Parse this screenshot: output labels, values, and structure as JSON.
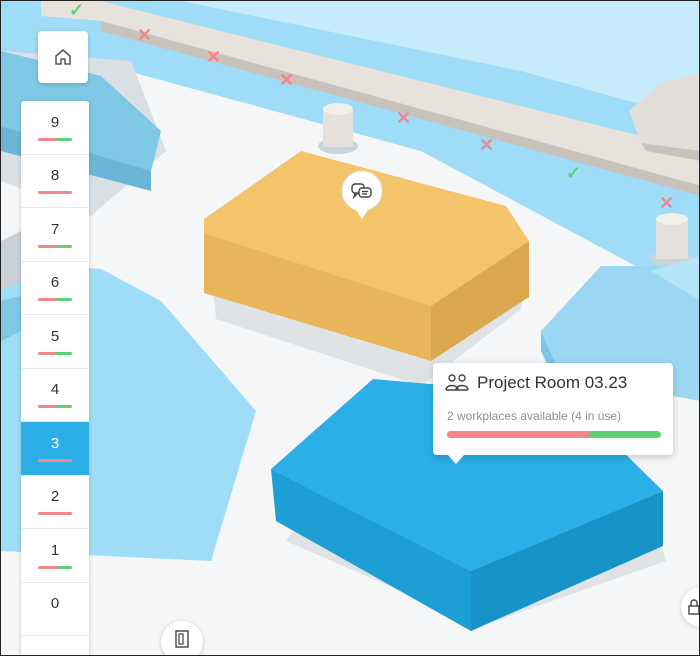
{
  "floors": [
    {
      "label": "9",
      "status_color": "#5fd175"
    },
    {
      "label": "8",
      "status_color": "#f2868a"
    },
    {
      "label": "7",
      "status_color": "#5fd175"
    },
    {
      "label": "6",
      "status_color": "#5fd175"
    },
    {
      "label": "5",
      "status_color": "#5fd175"
    },
    {
      "label": "4",
      "status_color": "#5fd175"
    },
    {
      "label": "3",
      "status_color": "#f2868a",
      "selected": true
    },
    {
      "label": "2",
      "status_color": "#f2868a"
    },
    {
      "label": "1",
      "status_color": "#5fd175"
    },
    {
      "label": "0",
      "status_color": ""
    }
  ],
  "tooltip": {
    "title": "Project Room 03.23",
    "subtitle": "2 workplaces available (4 in use)",
    "used_fraction": 0.667,
    "colors": {
      "used": "#f2868a",
      "available": "#5fd175"
    }
  },
  "colors": {
    "water": "#9fdcf7",
    "floor": "#f4f6f7",
    "selected_room": "#2bafe6",
    "meeting_room": "#f3c469",
    "floor_selected": "#2bafe6"
  },
  "icons": {
    "home": "home-icon",
    "room": "people-icon",
    "pin": "chat-bubbles-icon",
    "bottom": "door-icon"
  }
}
